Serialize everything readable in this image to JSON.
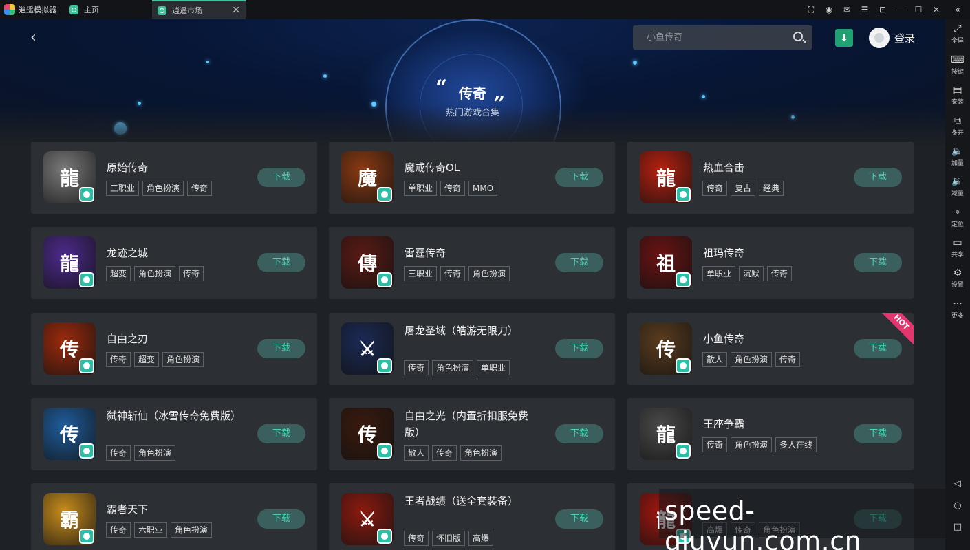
{
  "titlebar": {
    "app_name": "逍遥模拟器",
    "tabs": [
      {
        "label": "主页"
      },
      {
        "label": "逍遥市场",
        "active": true
      }
    ]
  },
  "header": {
    "search_placeholder": "小鱼传奇",
    "login_label": "登录"
  },
  "hero": {
    "open_quote": "“",
    "close_quote": "”",
    "title": "传奇",
    "subtitle": "热门游戏合集"
  },
  "sidebar": {
    "items": [
      {
        "icon": "⤢",
        "label": "全屏"
      },
      {
        "icon": "⌨",
        "label": "按键"
      },
      {
        "icon": "▤",
        "label": "安装"
      },
      {
        "icon": "⧉",
        "label": "多开"
      },
      {
        "icon": "🔈",
        "label": "加量"
      },
      {
        "icon": "🔉",
        "label": "减量"
      },
      {
        "icon": "⌖",
        "label": "定位"
      },
      {
        "icon": "▭",
        "label": "共享"
      },
      {
        "icon": "⚙",
        "label": "设置"
      },
      {
        "icon": "···",
        "label": "更多"
      }
    ]
  },
  "download_label": "下载",
  "hot_label": "HOT",
  "games": [
    {
      "name": "原始传奇",
      "tags": [
        "三职业",
        "角色扮演",
        "传奇"
      ],
      "icon_char": "龍",
      "icon_bg": "#7a7a7a"
    },
    {
      "name": "魔戒传奇OL",
      "tags": [
        "单职业",
        "传奇",
        "MMO"
      ],
      "icon_char": "魔",
      "icon_bg": "#8a3a12"
    },
    {
      "name": "热血合击",
      "tags": [
        "传奇",
        "复古",
        "经典"
      ],
      "icon_char": "龍",
      "icon_bg": "#b5200f"
    },
    {
      "name": "龙迹之城",
      "tags": [
        "超变",
        "角色扮演",
        "传奇"
      ],
      "icon_char": "龍",
      "icon_bg": "#4d2a8c"
    },
    {
      "name": "雷霆传奇",
      "tags": [
        "三职业",
        "传奇",
        "角色扮演"
      ],
      "icon_char": "傳",
      "icon_bg": "#5a1a14"
    },
    {
      "name": "祖玛传奇",
      "tags": [
        "单职业",
        "沉默",
        "传奇"
      ],
      "icon_char": "祖",
      "icon_bg": "#6a1212"
    },
    {
      "name": "自由之刃",
      "tags": [
        "传奇",
        "超变",
        "角色扮演"
      ],
      "icon_char": "传",
      "icon_bg": "#9c2a0c"
    },
    {
      "name": "屠龙圣域（皓游无限刀）",
      "tags": [
        "传奇",
        "角色扮演",
        "单职业"
      ],
      "icon_char": "⚔",
      "icon_bg": "#1b2a55"
    },
    {
      "name": "小鱼传奇",
      "tags": [
        "散人",
        "角色扮演",
        "传奇"
      ],
      "icon_char": "传",
      "icon_bg": "#5a3c1e",
      "hot": true
    },
    {
      "name": "弑神斩仙（冰雪传奇免费版）",
      "tags": [
        "传奇",
        "角色扮演"
      ],
      "icon_char": "传",
      "icon_bg": "#1f5d9c"
    },
    {
      "name": "自由之光（内置折扣服免费版）",
      "tags": [
        "散人",
        "传奇",
        "角色扮演"
      ],
      "icon_char": "传",
      "icon_bg": "#3a1a0e"
    },
    {
      "name": "王座争霸",
      "tags": [
        "传奇",
        "角色扮演",
        "多人在线"
      ],
      "icon_char": "龍",
      "icon_bg": "#4a4a4a"
    },
    {
      "name": "霸者天下",
      "tags": [
        "传奇",
        "六职业",
        "角色扮演"
      ],
      "icon_char": "霸",
      "icon_bg": "#c98d1c"
    },
    {
      "name": "王者战绩（送全套装备）",
      "tags": [
        "传奇",
        "怀旧版",
        "高爆"
      ],
      "icon_char": "⚔",
      "icon_bg": "#8c1a10"
    },
    {
      "name": "",
      "tags": [
        "高爆",
        "传奇",
        "角色扮演"
      ],
      "icon_char": "龍",
      "icon_bg": "#a0160f"
    }
  ],
  "watermark": "speed-qiuyun.com.cn"
}
